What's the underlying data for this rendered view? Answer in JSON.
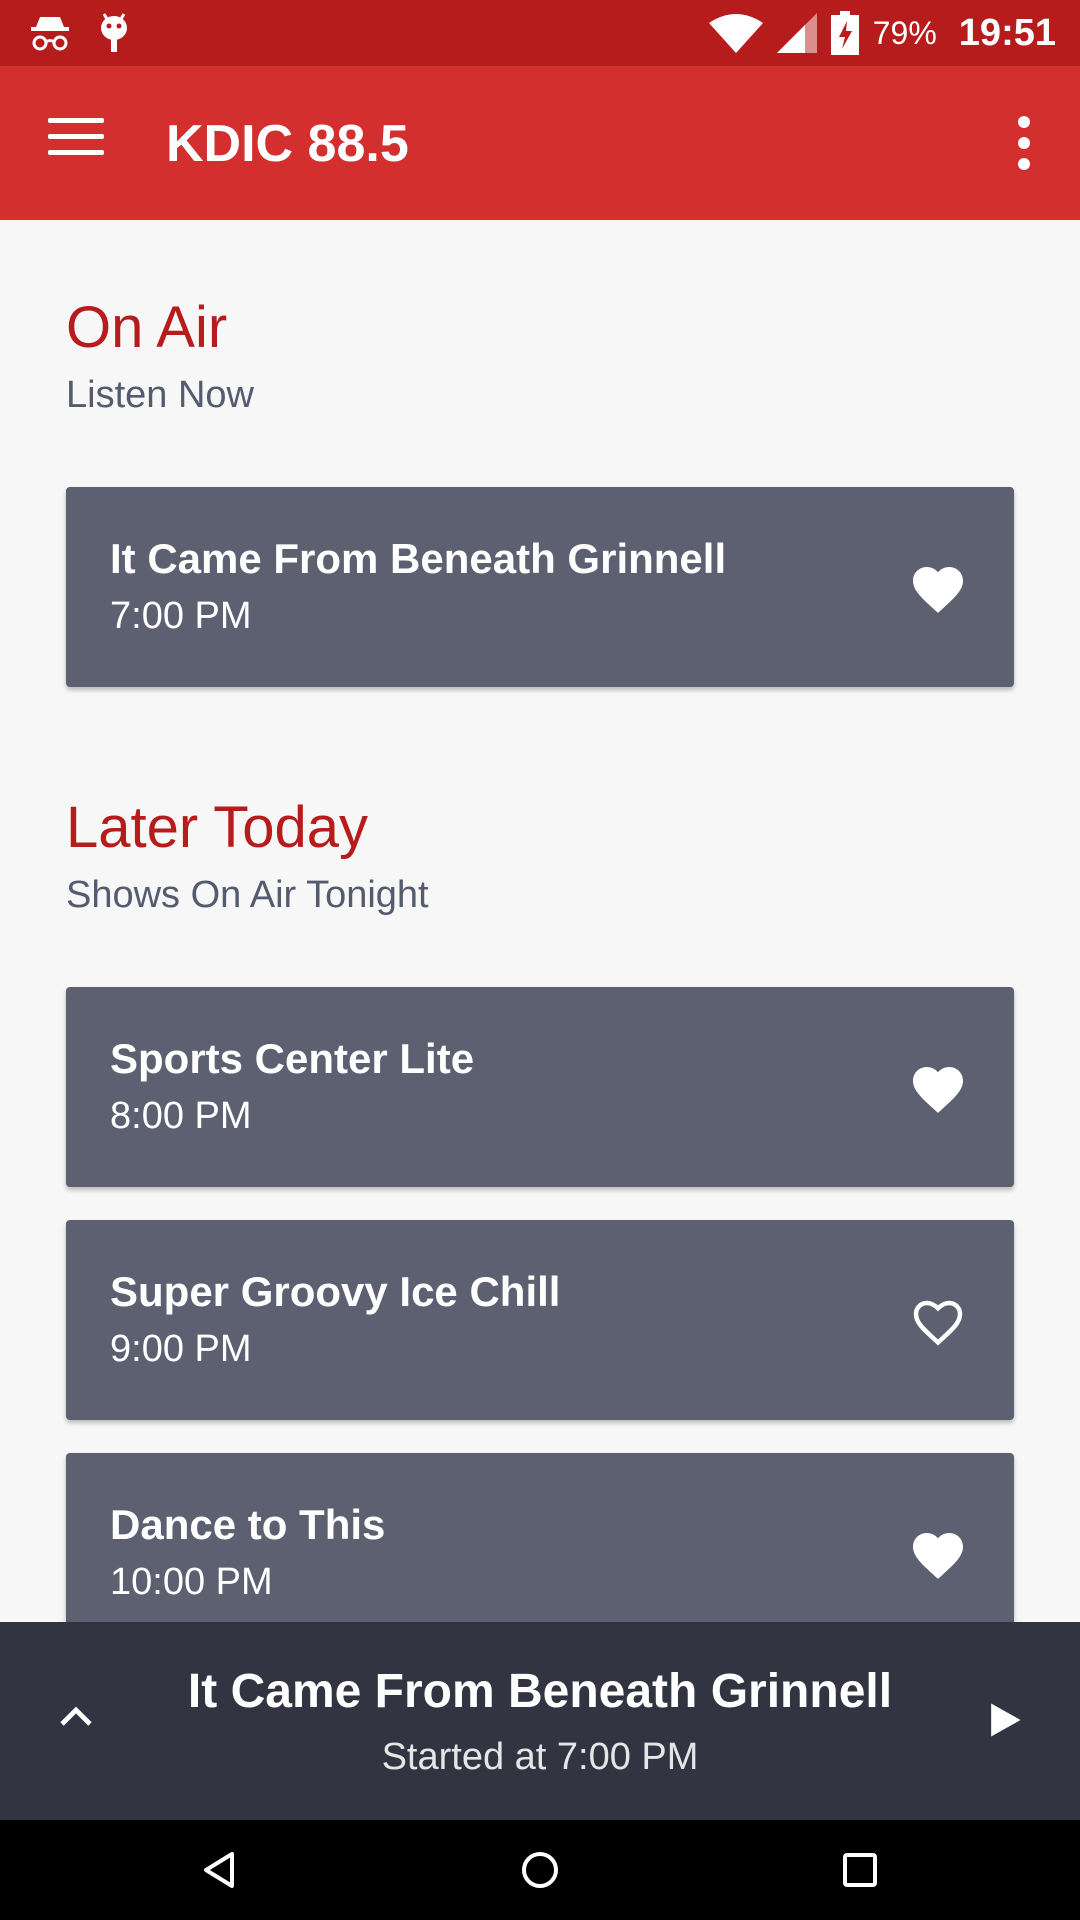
{
  "status_bar": {
    "battery_pct": "79%",
    "time": "19:51"
  },
  "app_bar": {
    "title": "KDIC 88.5"
  },
  "on_air": {
    "title": "On Air",
    "subtitle": "Listen Now",
    "show": {
      "title": "It Came From Beneath Grinnell",
      "time": "7:00 PM",
      "favorited": true
    }
  },
  "later_today": {
    "title": "Later Today",
    "subtitle": "Shows On Air Tonight",
    "shows": [
      {
        "title": "Sports Center Lite",
        "time": "8:00 PM",
        "favorited": true
      },
      {
        "title": "Super Groovy Ice Chill",
        "time": "9:00 PM",
        "favorited": false
      },
      {
        "title": "Dance to This",
        "time": "10:00 PM",
        "favorited": true
      }
    ]
  },
  "player": {
    "title": "It Came From Beneath Grinnell",
    "subtitle": "Started at 7:00 PM"
  },
  "colors": {
    "status_bar": "#b71c1c",
    "app_bar": "#d32f2f",
    "section_title": "#b71c1c",
    "card": "#5c6070",
    "player": "#323441"
  },
  "icons": {
    "status_left": [
      "incognito-icon",
      "android-debug-icon"
    ],
    "status_right": [
      "wifi-icon",
      "signal-icon",
      "battery-charging-icon"
    ],
    "app_bar": [
      "menu-icon",
      "overflow-menu-icon"
    ],
    "player": [
      "chevron-up-icon",
      "play-icon"
    ],
    "nav": [
      "back-icon",
      "home-icon",
      "recents-icon"
    ]
  }
}
